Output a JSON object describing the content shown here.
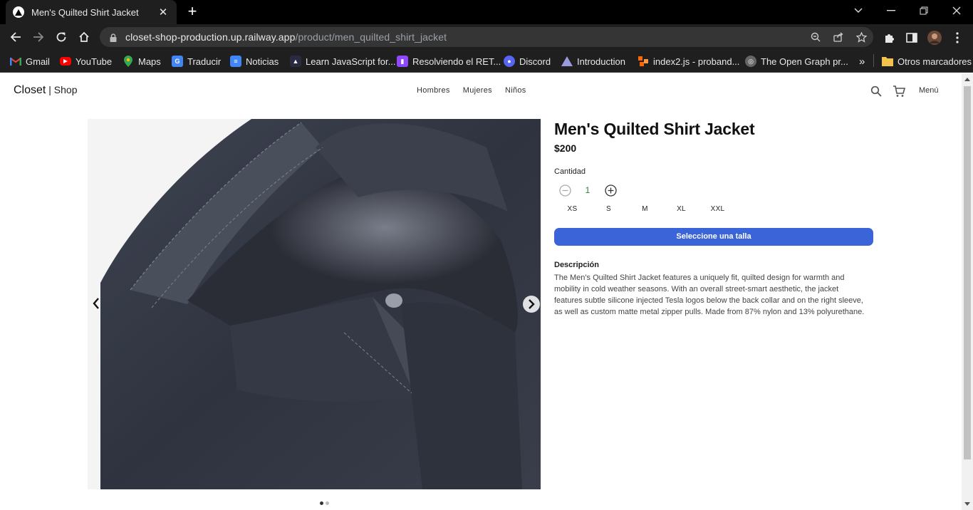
{
  "browser": {
    "tab_title": "Men's Quilted Shirt Jacket",
    "url_host": "closet-shop-production.up.railway.app",
    "url_path": "/product/men_quilted_shirt_jacket",
    "bookmarks": [
      {
        "label": "Gmail",
        "icon": "gmail-icon",
        "color": "#ea4335"
      },
      {
        "label": "YouTube",
        "icon": "youtube-icon",
        "color": "#ff0000"
      },
      {
        "label": "Maps",
        "icon": "maps-icon",
        "color": "#34a853"
      },
      {
        "label": "Traducir",
        "icon": "translate-icon",
        "color": "#4285f4"
      },
      {
        "label": "Noticias",
        "icon": "news-icon",
        "color": "#4285f4"
      },
      {
        "label": "Learn JavaScript for...",
        "icon": "freecodecamp-icon",
        "color": "#888888"
      },
      {
        "label": "Resolviendo el RET...",
        "icon": "twitch-icon",
        "color": "#9146ff"
      },
      {
        "label": "Discord",
        "icon": "discord-icon",
        "color": "#5865f2"
      },
      {
        "label": "Introduction",
        "icon": "introduction-icon",
        "color": "#8888cc"
      },
      {
        "label": "index2.js - proband...",
        "icon": "codepen-icon",
        "color": "#ff6600"
      },
      {
        "label": "The Open Graph pr...",
        "icon": "opengraph-icon",
        "color": "#777777"
      }
    ],
    "overflow_label": "»",
    "other_bookmarks": "Otros marcadores"
  },
  "header": {
    "logo_brand": "Closet",
    "logo_sep": " | ",
    "logo_sub": "Shop",
    "nav": [
      "Hombres",
      "Mujeres",
      "Niños"
    ],
    "menu_label": "Menú"
  },
  "product": {
    "title": "Men's Quilted Shirt Jacket",
    "price": "$200",
    "quantity_label": "Cantidad",
    "quantity": "1",
    "sizes": [
      "XS",
      "S",
      "M",
      "XL",
      "XXL"
    ],
    "cta_label": "Seleccione una talla",
    "description_title": "Descripción",
    "description": "The Men's Quilted Shirt Jacket features a uniquely fit, quilted design for warmth and mobility in cold weather seasons. With an overall street-smart aesthetic, the jacket features subtle silicone injected Tesla logos below the back collar and on the right sleeve, as well as custom matte metal zipper pulls. Made from 87% nylon and 13% polyurethane.",
    "slides_total": 2,
    "slide_active": 1
  },
  "colors": {
    "accent": "#3b64d8",
    "quantity": "#2e7d32"
  }
}
